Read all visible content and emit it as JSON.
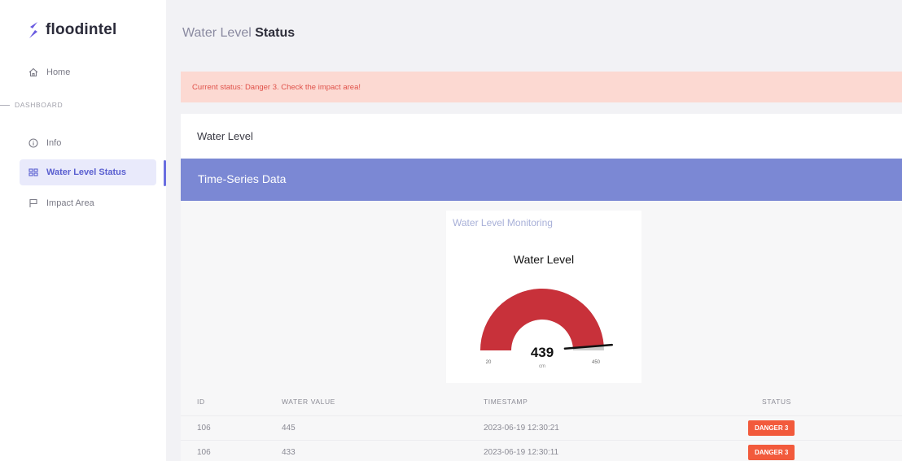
{
  "brand": {
    "name": "floodintel"
  },
  "sidebar": {
    "home_label": "Home",
    "section_label": "DASHBOARD",
    "items": [
      {
        "label": "Info",
        "icon": "info-icon"
      },
      {
        "label": "Water Level Status",
        "icon": "grid-icon",
        "active": true
      },
      {
        "label": "Impact Area",
        "icon": "flag-icon"
      }
    ]
  },
  "header": {
    "title_prefix": "Water Level",
    "title_bold": "Status"
  },
  "alert": {
    "text": "Current status: Danger 3. Check the impact area!"
  },
  "card": {
    "title": "Water Level",
    "section_title": "Time-Series Data",
    "gauge": {
      "caption": "Water Level Monitoring",
      "title": "Water Level",
      "value": 439,
      "unit": "cm",
      "min": 20,
      "max": 450,
      "min_label": "20",
      "max_label": "450"
    }
  },
  "table": {
    "headers": [
      "ID",
      "WATER VALUE",
      "TIMESTAMP",
      "STATUS"
    ],
    "rows": [
      {
        "id": "106",
        "value": "445",
        "timestamp": "2023-06-19 12:30:21",
        "status": "DANGER 3"
      },
      {
        "id": "106",
        "value": "433",
        "timestamp": "2023-06-19 12:30:11",
        "status": "DANGER 3"
      }
    ]
  },
  "colors": {
    "accent": "#6a6ee0",
    "section_bar": "#7b88d4",
    "gauge_fill": "#c8313a",
    "gauge_bg": "#cccccc",
    "danger_badge": "#f25a3c",
    "alert_bg": "#fcd9d2"
  }
}
